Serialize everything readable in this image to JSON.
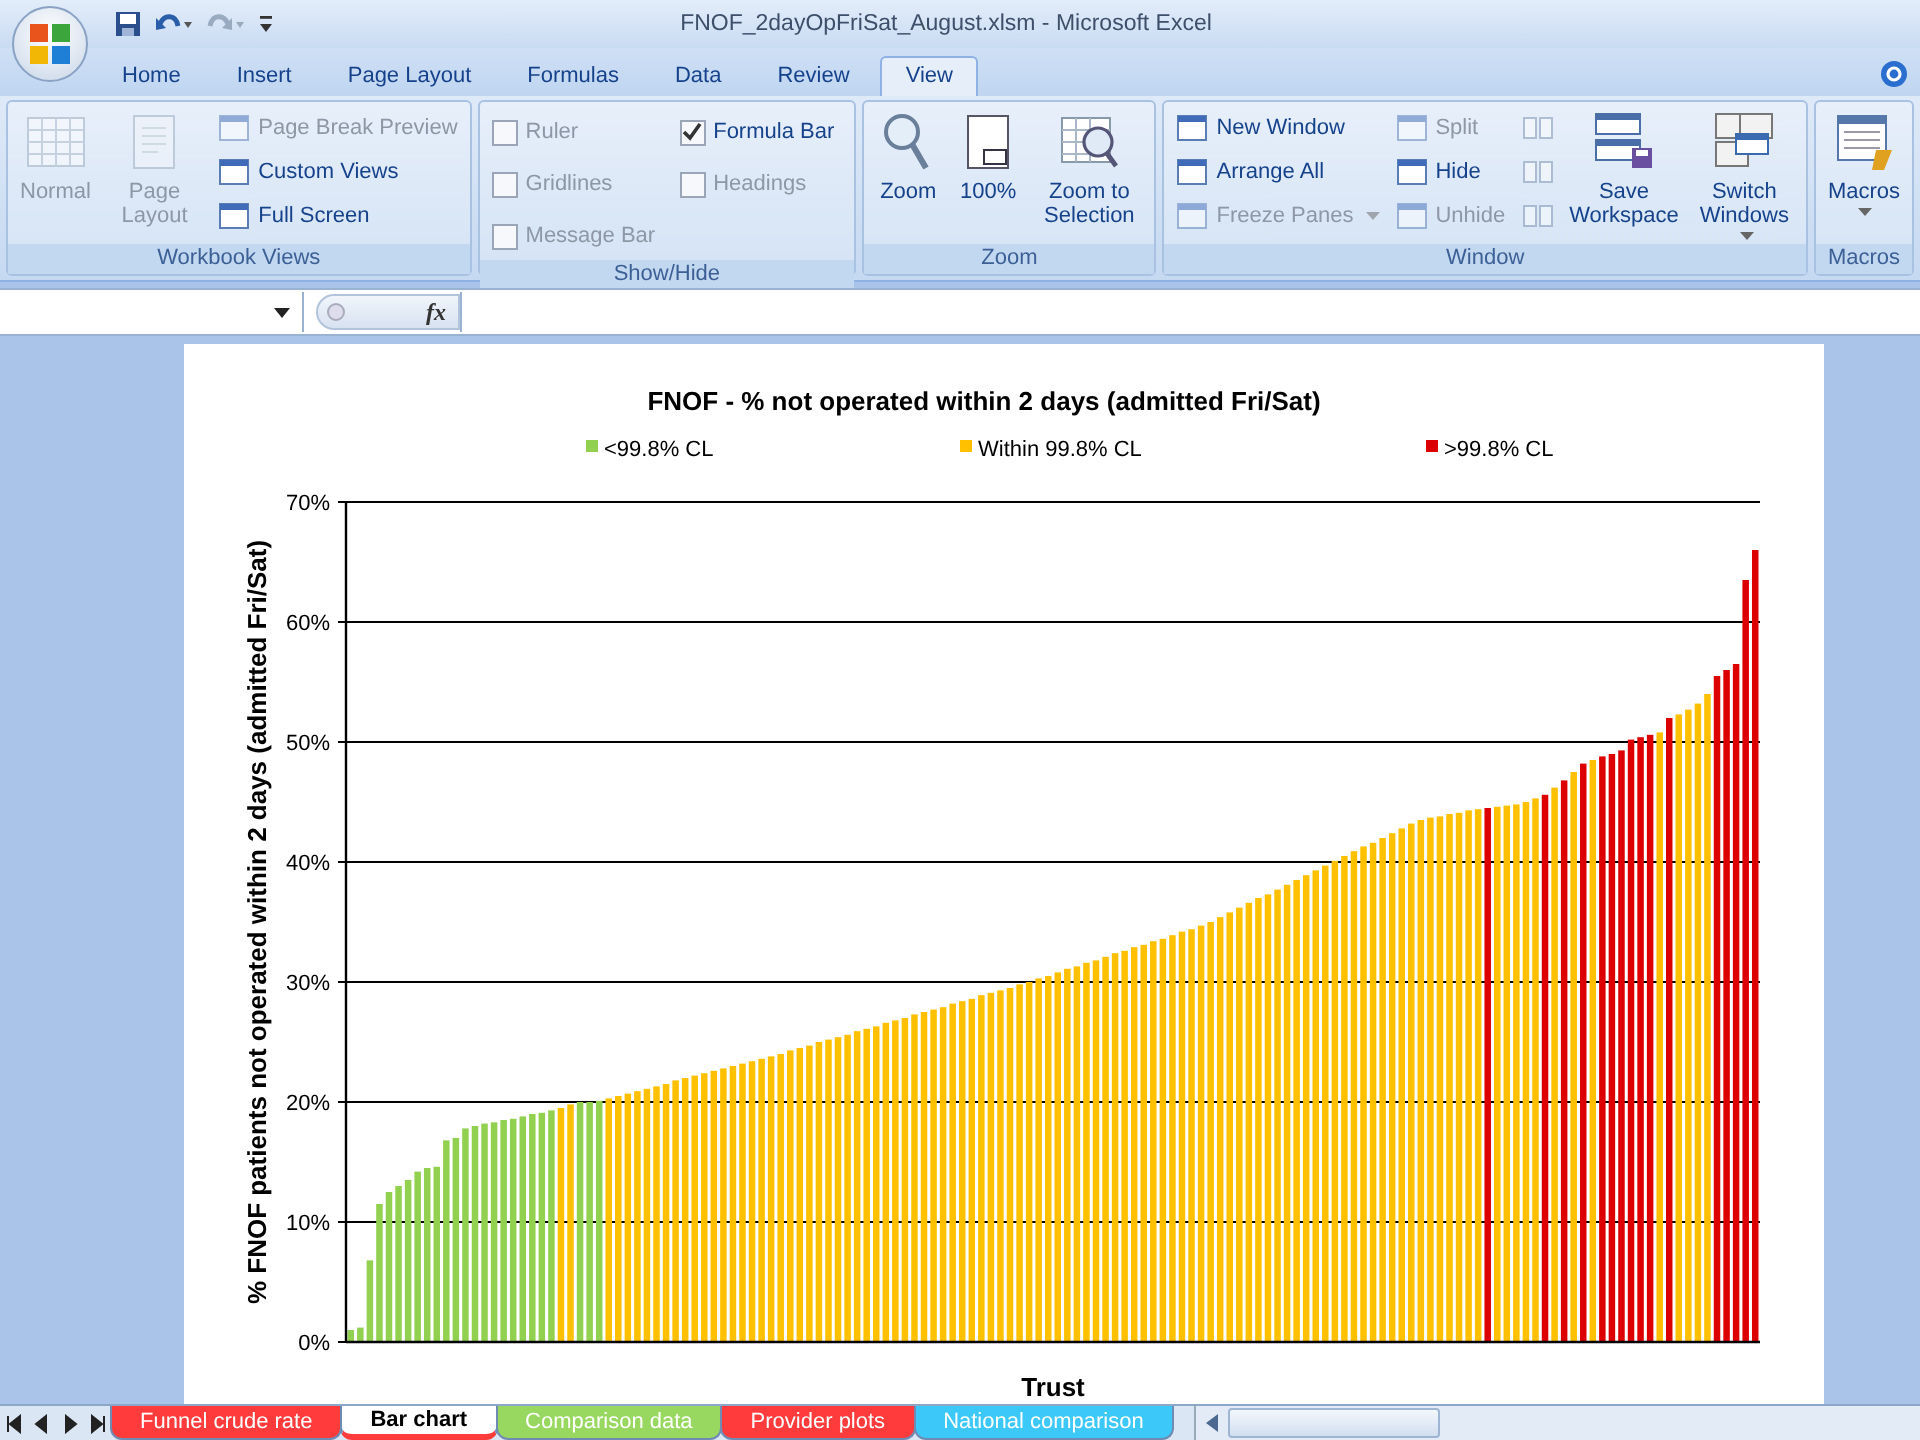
{
  "window": {
    "title": "FNOF_2dayOpFriSat_August.xlsm - Microsoft Excel"
  },
  "tabs": [
    {
      "label": "Home",
      "selected": false
    },
    {
      "label": "Insert",
      "selected": false
    },
    {
      "label": "Page Layout",
      "selected": false
    },
    {
      "label": "Formulas",
      "selected": false
    },
    {
      "label": "Data",
      "selected": false
    },
    {
      "label": "Review",
      "selected": false
    },
    {
      "label": "View",
      "selected": true
    }
  ],
  "ribbon": {
    "groups": [
      {
        "title": "Workbook Views",
        "items": [
          {
            "kind": "large",
            "label": "Normal",
            "disabled": true
          },
          {
            "kind": "large",
            "label": "Page Layout",
            "disabled": true
          },
          {
            "kind": "small",
            "label": "Page Break Preview",
            "disabled": true
          },
          {
            "kind": "small",
            "label": "Custom Views",
            "disabled": false
          },
          {
            "kind": "small",
            "label": "Full Screen",
            "disabled": false
          }
        ]
      },
      {
        "title": "Show/Hide",
        "items": [
          {
            "kind": "check",
            "label": "Ruler",
            "checked": false,
            "disabled": true
          },
          {
            "kind": "check",
            "label": "Gridlines",
            "checked": false,
            "disabled": true
          },
          {
            "kind": "check",
            "label": "Message Bar",
            "checked": false,
            "disabled": true
          },
          {
            "kind": "check",
            "label": "Formula Bar",
            "checked": true,
            "disabled": false
          },
          {
            "kind": "check",
            "label": "Headings",
            "checked": false,
            "disabled": true
          }
        ]
      },
      {
        "title": "Zoom",
        "items": [
          {
            "kind": "large",
            "label": "Zoom",
            "disabled": false
          },
          {
            "kind": "large",
            "label": "100%",
            "disabled": false
          },
          {
            "kind": "large",
            "label": "Zoom to Selection",
            "disabled": false
          }
        ]
      },
      {
        "title": "Window",
        "items": [
          {
            "kind": "small",
            "label": "New Window",
            "disabled": false
          },
          {
            "kind": "small",
            "label": "Arrange All",
            "disabled": false
          },
          {
            "kind": "small",
            "label": "Freeze Panes",
            "disabled": true,
            "dropdown": true
          },
          {
            "kind": "small",
            "label": "Split",
            "disabled": true
          },
          {
            "kind": "small",
            "label": "Hide",
            "disabled": false
          },
          {
            "kind": "small",
            "label": "Unhide",
            "disabled": true
          },
          {
            "kind": "icon",
            "disabled": true
          },
          {
            "kind": "icon",
            "disabled": true
          },
          {
            "kind": "icon",
            "disabled": true
          },
          {
            "kind": "large",
            "label": "Save Workspace",
            "disabled": false
          },
          {
            "kind": "large",
            "label": "Switch Windows",
            "disabled": false,
            "dropdown": true
          }
        ]
      },
      {
        "title": "Macros",
        "items": [
          {
            "kind": "large",
            "label": "Macros",
            "disabled": false,
            "dropdown": true
          }
        ]
      }
    ]
  },
  "formula_bar": {
    "function_label": "fx"
  },
  "sheet": {
    "chart_data": {
      "type": "bar",
      "title": "FNOF - % not operated within 2 days (admitted Fri/Sat)",
      "xlabel": "Trust",
      "ylabel": "% FNOF patients not operated within 2 days (admitted Fri/Sat)",
      "ylim": [
        0,
        70
      ],
      "grid": true,
      "legend": "top",
      "yticks": [
        {
          "value": 0,
          "label": "0%"
        },
        {
          "value": 10,
          "label": "10%"
        },
        {
          "value": 20,
          "label": "20%"
        },
        {
          "value": 30,
          "label": "30%"
        },
        {
          "value": 40,
          "label": "40%"
        },
        {
          "value": 50,
          "label": "50%"
        },
        {
          "value": 60,
          "label": "60%"
        },
        {
          "value": 70,
          "label": "70%"
        }
      ],
      "series": [
        {
          "name": "<99.8% CL",
          "color": "#92d050",
          "values": [
            1.0,
            1.2,
            6.8,
            11.5,
            12.5,
            13.0,
            13.5,
            14.2,
            14.5,
            14.6,
            16.8,
            17.0,
            17.8,
            18.0,
            18.2,
            18.3,
            18.5,
            18.6,
            18.8,
            19.0,
            19.1,
            19.3,
            null,
            null,
            20.0,
            20.0,
            20.1,
            null,
            null,
            null,
            null,
            null,
            null,
            null,
            null,
            null,
            null,
            null,
            null,
            null,
            null,
            null,
            null,
            null,
            null,
            null,
            null,
            null,
            null,
            null,
            null,
            null,
            null,
            null,
            null,
            null,
            null,
            null,
            null,
            null,
            null,
            null,
            null,
            null,
            null,
            null,
            null,
            null,
            null,
            null,
            null,
            null,
            null,
            null,
            null,
            null,
            null,
            null,
            null,
            null,
            null,
            null,
            null,
            null,
            null,
            null,
            null,
            null,
            null,
            null,
            null,
            null,
            null,
            null,
            null,
            null,
            null,
            null,
            null,
            null,
            null,
            null,
            null,
            null,
            null,
            null,
            null,
            null,
            null,
            null,
            null,
            null,
            null,
            null,
            null,
            null,
            null,
            null,
            null,
            null,
            null,
            null,
            null,
            null,
            null,
            null,
            null,
            null,
            null,
            null,
            null,
            null,
            null,
            null,
            null,
            null,
            null,
            null,
            null,
            null,
            null,
            null,
            null,
            null,
            null,
            null,
            null,
            null
          ]
        },
        {
          "name": "Within 99.8% CL",
          "color": "#ffc000",
          "values": [
            null,
            null,
            null,
            null,
            null,
            null,
            null,
            null,
            null,
            null,
            null,
            null,
            null,
            null,
            null,
            null,
            null,
            null,
            null,
            null,
            null,
            null,
            19.5,
            19.8,
            null,
            null,
            null,
            20.3,
            20.5,
            20.7,
            20.9,
            21.1,
            21.3,
            21.5,
            21.8,
            22.0,
            22.2,
            22.4,
            22.6,
            22.8,
            23.0,
            23.2,
            23.4,
            23.6,
            23.8,
            24.0,
            24.3,
            24.5,
            24.7,
            25.0,
            25.2,
            25.4,
            25.6,
            25.9,
            26.1,
            26.3,
            26.6,
            26.8,
            27.0,
            27.3,
            27.5,
            27.7,
            27.9,
            28.2,
            28.4,
            28.6,
            28.9,
            29.1,
            29.3,
            29.5,
            29.8,
            30.0,
            30.3,
            30.5,
            30.8,
            31.1,
            31.3,
            31.6,
            31.8,
            32.1,
            32.4,
            32.6,
            32.9,
            33.1,
            33.4,
            33.6,
            33.9,
            34.2,
            34.4,
            34.7,
            35.0,
            35.4,
            35.8,
            36.2,
            36.6,
            37.0,
            37.3,
            37.7,
            38.1,
            38.5,
            38.9,
            39.3,
            39.7,
            40.1,
            40.5,
            40.9,
            41.3,
            41.6,
            42.0,
            42.4,
            42.8,
            43.2,
            43.5,
            43.7,
            43.8,
            44.0,
            44.1,
            44.3,
            44.4,
            null,
            44.6,
            44.7,
            44.8,
            45.0,
            45.3,
            null,
            46.2,
            null,
            47.5,
            null,
            48.5,
            null,
            null,
            null,
            null,
            null,
            null,
            50.8,
            null,
            52.3,
            52.7,
            53.2,
            54.0,
            null,
            null,
            null,
            null,
            null
          ]
        },
        {
          "name": ">99.8% CL",
          "color": "#dd0000",
          "values": [
            null,
            null,
            null,
            null,
            null,
            null,
            null,
            null,
            null,
            null,
            null,
            null,
            null,
            null,
            null,
            null,
            null,
            null,
            null,
            null,
            null,
            null,
            null,
            null,
            null,
            null,
            null,
            null,
            null,
            null,
            null,
            null,
            null,
            null,
            null,
            null,
            null,
            null,
            null,
            null,
            null,
            null,
            null,
            null,
            null,
            null,
            null,
            null,
            null,
            null,
            null,
            null,
            null,
            null,
            null,
            null,
            null,
            null,
            null,
            null,
            null,
            null,
            null,
            null,
            null,
            null,
            null,
            null,
            null,
            null,
            null,
            null,
            null,
            null,
            null,
            null,
            null,
            null,
            null,
            null,
            null,
            null,
            null,
            null,
            null,
            null,
            null,
            null,
            null,
            null,
            null,
            null,
            null,
            null,
            null,
            null,
            null,
            null,
            null,
            null,
            null,
            null,
            null,
            null,
            null,
            null,
            null,
            null,
            null,
            null,
            null,
            null,
            null,
            null,
            null,
            null,
            null,
            null,
            null,
            44.5,
            null,
            null,
            null,
            null,
            null,
            45.6,
            null,
            46.8,
            null,
            48.2,
            null,
            48.8,
            49.0,
            49.3,
            50.2,
            50.4,
            50.6,
            null,
            52.0,
            null,
            null,
            null,
            null,
            55.5,
            56.0,
            56.5,
            63.5,
            66.0
          ]
        }
      ]
    }
  },
  "sheet_tabs": [
    {
      "label": "Funnel crude rate",
      "color": "#ff3b3b",
      "selected": false
    },
    {
      "label": "Bar chart",
      "color": "#ff3b3b",
      "selected": true
    },
    {
      "label": "Comparison data",
      "color": "#99d860",
      "selected": false
    },
    {
      "label": "Provider plots",
      "color": "#ff3b3b",
      "selected": false
    },
    {
      "label": "National comparison",
      "color": "#3cc8f8",
      "selected": false
    }
  ]
}
